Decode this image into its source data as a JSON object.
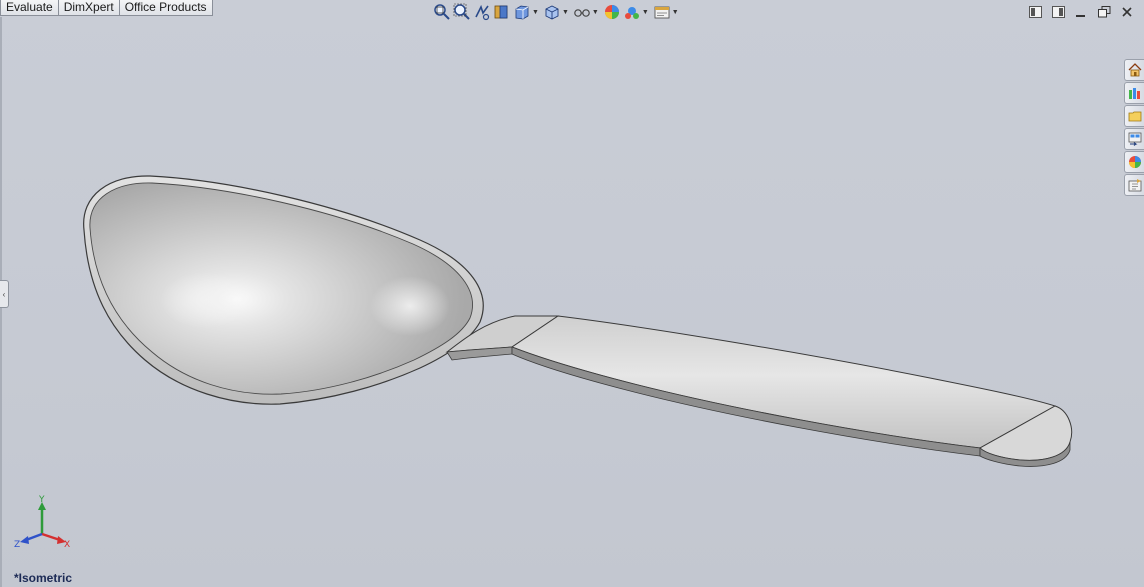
{
  "command_manager": {
    "tabs": [
      "Evaluate",
      "DimXpert",
      "Office Products"
    ]
  },
  "view_toolbar": {
    "buttons": [
      "zoom-to-fit-icon",
      "zoom-to-area-icon",
      "previous-view-icon",
      "section-view-icon",
      "view-orientation-icon",
      "display-style-icon",
      "hide-show-items-icon",
      "edit-appearance-icon",
      "apply-scene-icon",
      "view-settings-icon"
    ]
  },
  "task_pane": {
    "tabs": [
      "solidworks-resources-icon",
      "design-library-icon",
      "file-explorer-icon",
      "view-palette-icon",
      "appearances-scenes-icon",
      "custom-properties-icon"
    ]
  },
  "viewport": {
    "view_name": "*Isometric",
    "triad_axes": [
      "Y",
      "Z",
      "X"
    ],
    "colors": {
      "background": "#c8ccd5",
      "model": "#d6d6d6",
      "edges": "#3a3a3a",
      "axis_x": "#d43030",
      "axis_y": "#2e9b3a",
      "axis_z": "#2f52c9"
    }
  }
}
